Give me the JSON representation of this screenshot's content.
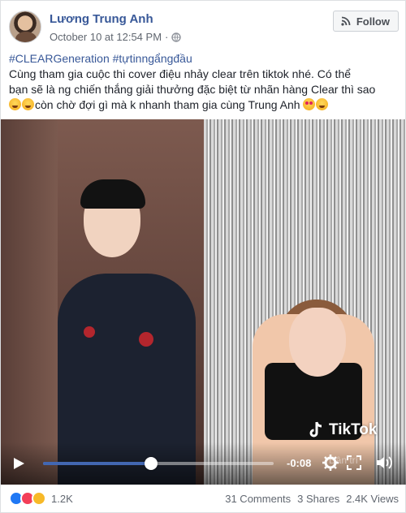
{
  "post": {
    "author": "Lương Trung Anh",
    "timestamp": "October 10 at 12:54 PM",
    "separator": "·",
    "follow_label": "Follow",
    "hashtags": "#CLEARGeneration #tựtinngẩngđầu",
    "body_line1": "Cùng tham gia cuộc thi cover điệu nhảy clear trên tiktok nhé. Có thể",
    "body_line2": "bạn sẽ là ng chiến thắng giải thưởng đặc biệt từ nhãn hàng Clear thì sao",
    "body_line3": "còn chờ đợi gì mà k nhanh tham gia cùng Trung Anh"
  },
  "video": {
    "brand_label": "TikTok",
    "time": "-0:08",
    "progress": 0.47,
    "watermark": "Dân trí"
  },
  "footer": {
    "reaction_count": "1.2K",
    "comments": "31 Comments",
    "shares": "3 Shares",
    "views": "2.4K Views"
  },
  "icons": {
    "globe": "globe-icon",
    "follow": "rss-icon",
    "play": "play-icon",
    "settings": "gear-icon",
    "fullscreen": "fullscreen-icon",
    "volume": "volume-icon",
    "reactions": [
      "like-reaction-icon",
      "love-reaction-icon",
      "haha-reaction-icon"
    ]
  },
  "colors": {
    "link": "#385898",
    "progress": "#4267b2",
    "like": "#2078f4",
    "love": "#f33e58",
    "haha": "#f7b928"
  }
}
